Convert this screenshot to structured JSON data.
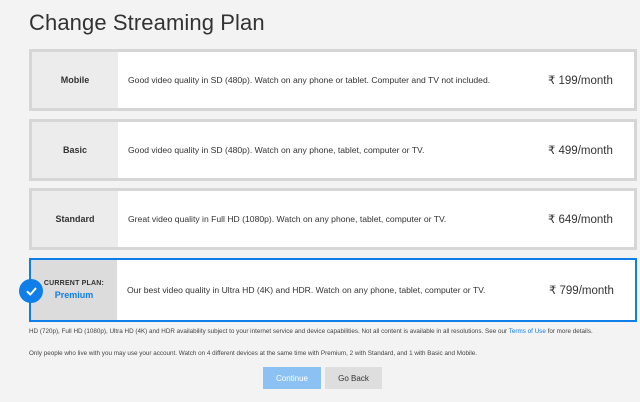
{
  "page": {
    "title": "Change Streaming Plan"
  },
  "plans": [
    {
      "name": "Mobile",
      "description": "Good video quality in SD (480p). Watch on any phone or tablet. Computer and TV not included.",
      "price": "₹ 199/month"
    },
    {
      "name": "Basic",
      "description": "Good video quality in SD (480p). Watch on any phone, tablet, computer or TV.",
      "price": "₹ 499/month"
    },
    {
      "name": "Standard",
      "description": "Great video quality in Full HD (1080p). Watch on any phone, tablet, computer or TV.",
      "price": "₹ 649/month"
    },
    {
      "current_label": "CURRENT PLAN:",
      "name": "Premium",
      "description": "Our best video quality in Ultra HD (4K) and HDR. Watch on any phone, tablet, computer or TV.",
      "price": "₹ 799/month",
      "selected": true
    }
  ],
  "footnotes": {
    "availability_text": "HD (720p), Full HD (1080p), Ultra HD (4K) and HDR availability subject to your internet service and device capabilities. Not all content is available in all resolutions. See our",
    "terms_link": "Terms of Use",
    "availability_suffix": "for more details.",
    "household": "Only people who live with you may use your account. Watch on 4 different devices at the same time with Premium, 2 with Standard, and 1 with Basic and Mobile."
  },
  "buttons": {
    "continue": "Continue",
    "back": "Go Back"
  },
  "colors": {
    "accent": "#0f7ee8",
    "continue_disabled": "#8cc2f3",
    "name_cell_bg": "#ececec",
    "page_bg": "#f3f3f3"
  },
  "icons": {
    "selected_badge": "checkmark-icon"
  }
}
